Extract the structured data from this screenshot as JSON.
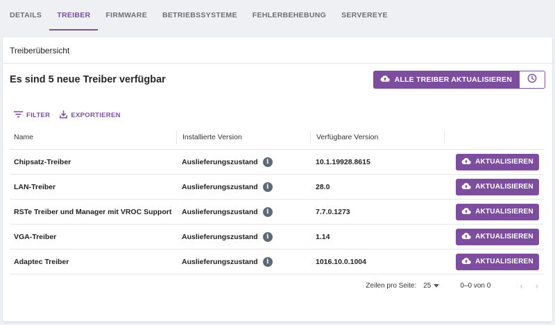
{
  "tabs": [
    {
      "label": "DETAILS"
    },
    {
      "label": "TREIBER",
      "active": true
    },
    {
      "label": "FIRMWARE"
    },
    {
      "label": "BETRIEBSSYSTEME"
    },
    {
      "label": "FEHLERBEHEBUNG"
    },
    {
      "label": "SERVEREYE"
    }
  ],
  "card": {
    "title": "Treiberübersicht",
    "summary": "Es sind 5 neue Treiber verfügbar",
    "update_all_label": "ALLE TREIBER AKTUALISIEREN",
    "clock_icon": "clock-icon"
  },
  "toolbar": {
    "filter_label": "FILTER",
    "export_label": "EXPORTIEREN"
  },
  "table": {
    "headers": {
      "name": "Name",
      "installed": "Installierte Version",
      "available": "Verfügbare Version"
    },
    "rows": [
      {
        "name": "Chipsatz-Treiber",
        "installed": "Auslieferungszustand",
        "available": "10.1.19928.8615",
        "action": "AKTUALISIEREN"
      },
      {
        "name": "LAN-Treiber",
        "installed": "Auslieferungszustand",
        "available": "28.0",
        "action": "AKTUALISIEREN"
      },
      {
        "name": "RSTe Treiber und Manager mit VROC Support",
        "installed": "Auslieferungszustand",
        "available": "7.7.0.1273",
        "action": "AKTUALISIEREN"
      },
      {
        "name": "VGA-Treiber",
        "installed": "Auslieferungszustand",
        "available": "1.14",
        "action": "AKTUALISIEREN"
      },
      {
        "name": "Adaptec Treiber",
        "installed": "Auslieferungszustand",
        "available": "1016.10.0.1004",
        "action": "AKTUALISIEREN"
      }
    ]
  },
  "pagination": {
    "rows_per_page_label": "Zeilen pro Seite:",
    "rows_per_page_value": "25",
    "range": "0–0 von 0"
  },
  "colors": {
    "accent": "#7d4d9e",
    "tab_active": "#7a4f9a",
    "info_icon": "#5f6a78"
  }
}
